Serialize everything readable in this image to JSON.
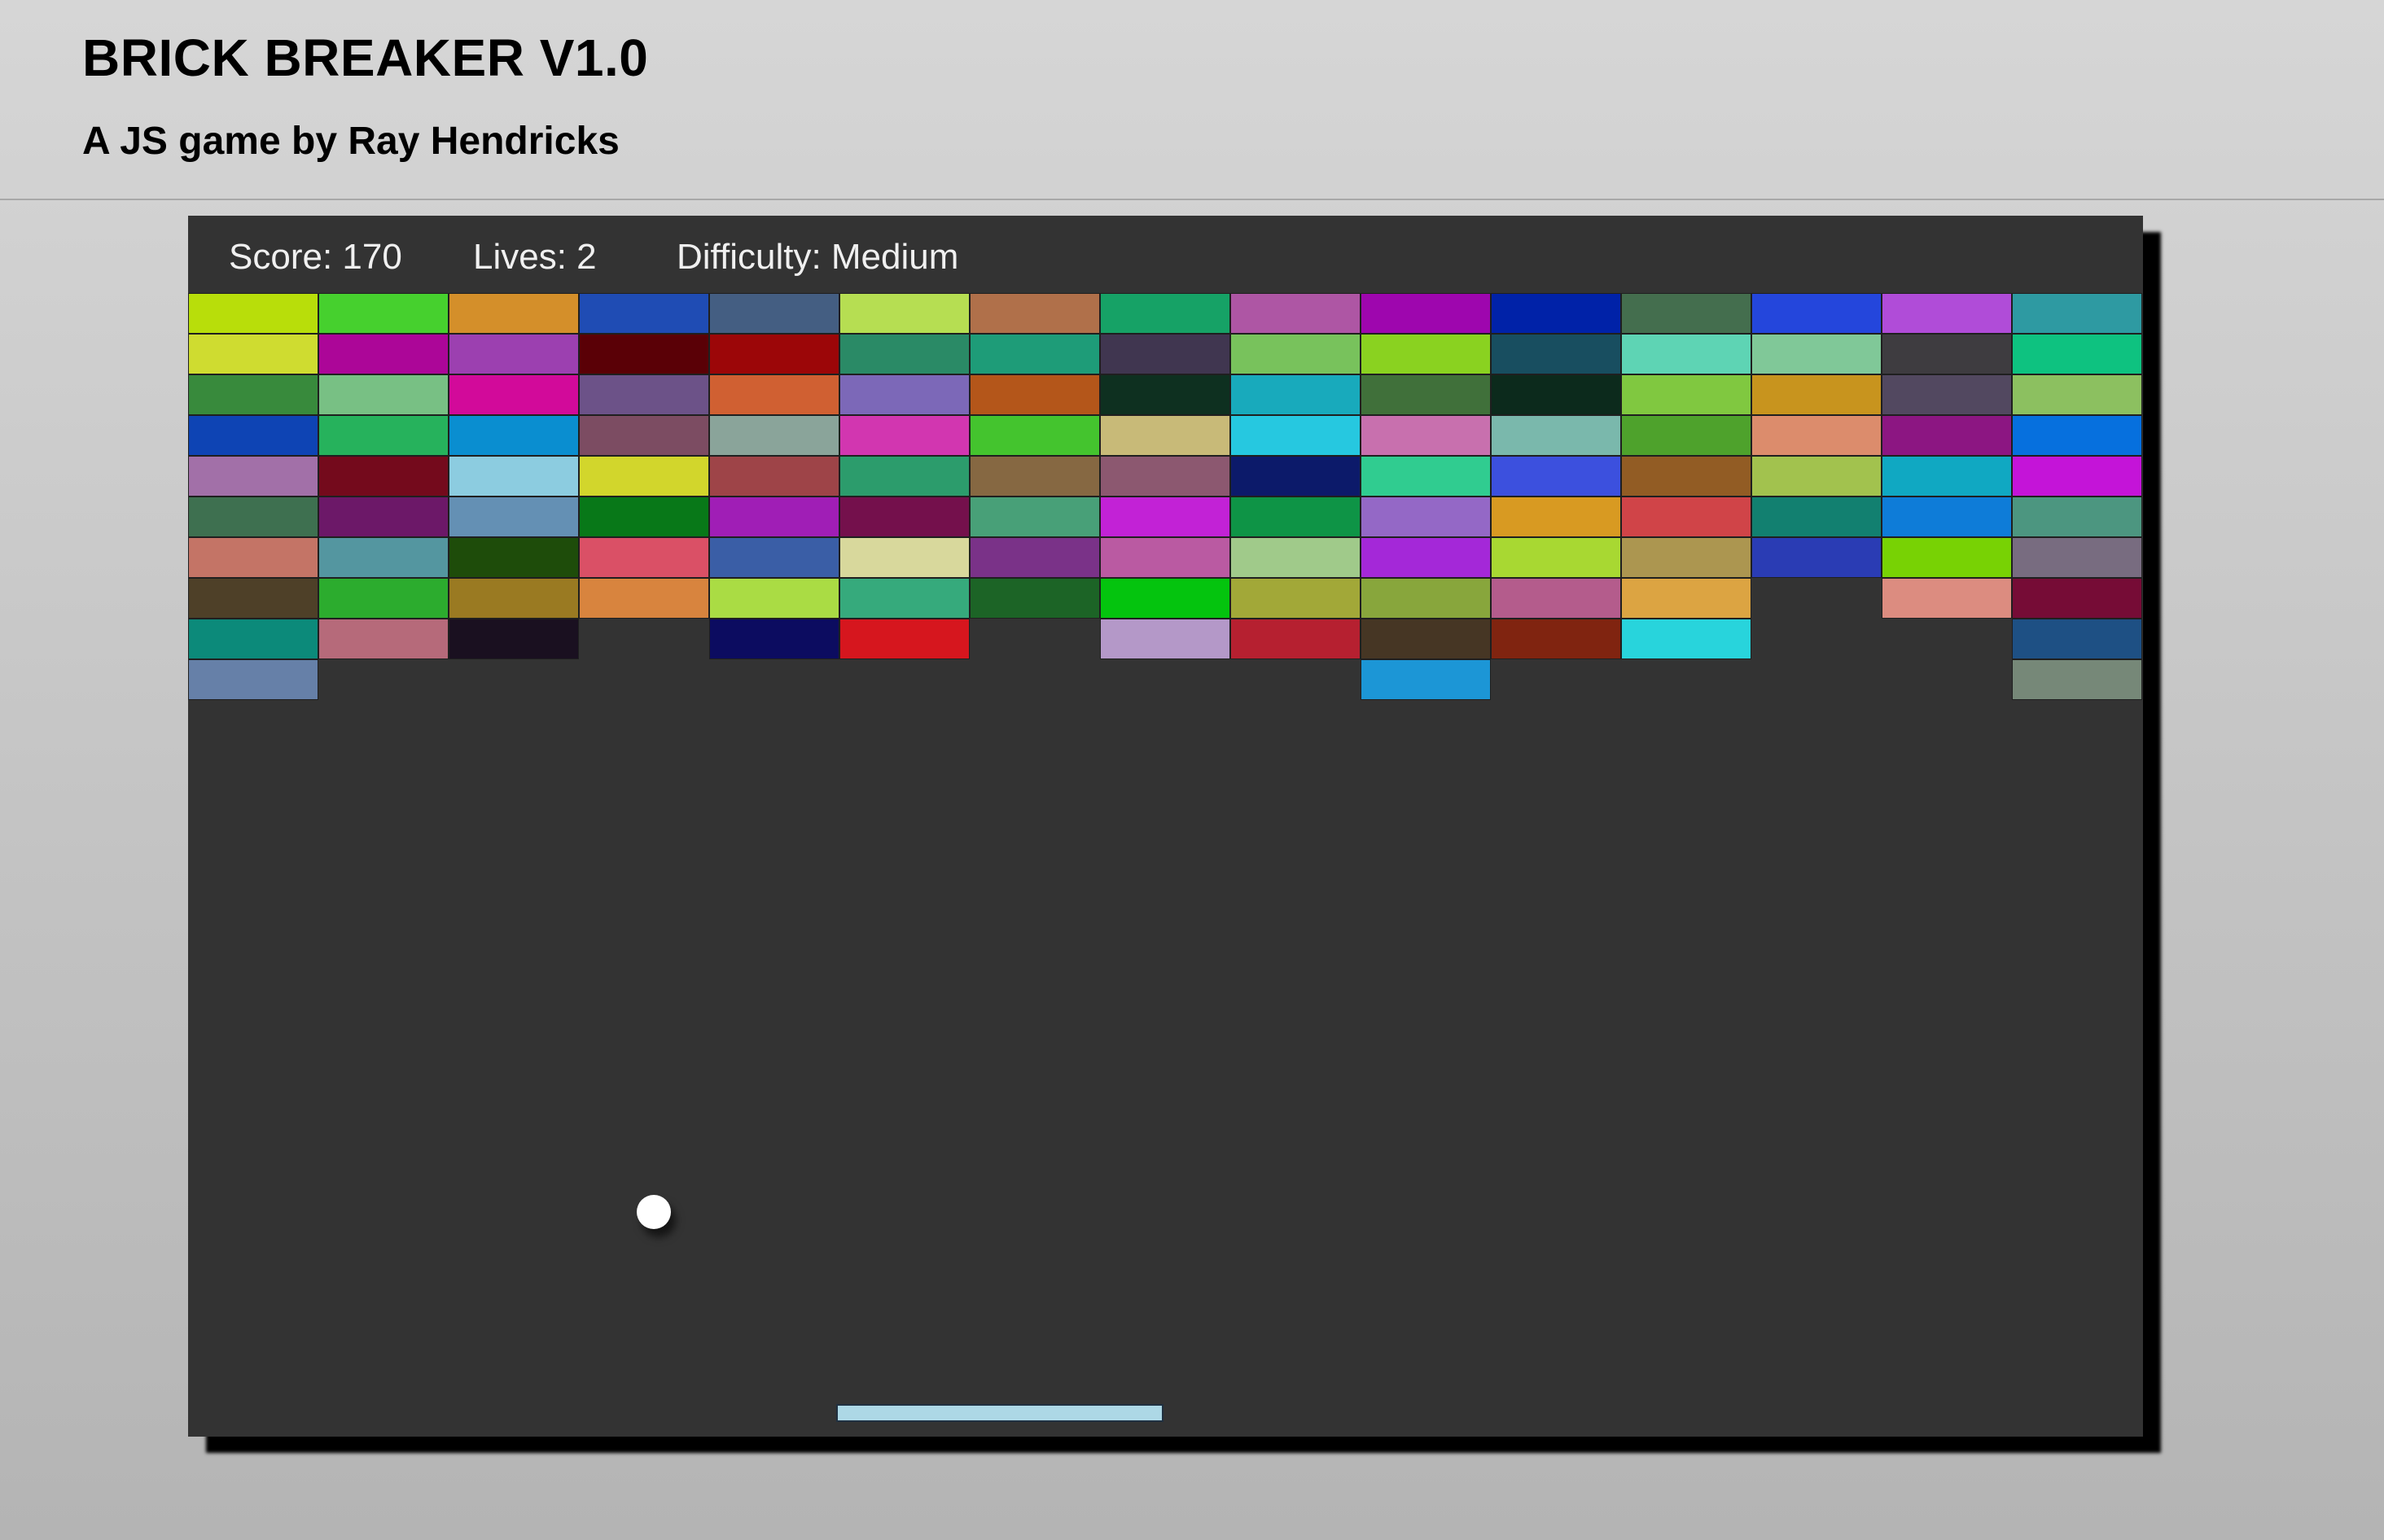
{
  "header": {
    "title": "BRICK BREAKER V1.0",
    "subtitle": "A JS game by Ray Hendricks"
  },
  "hud": {
    "score": "Score: 170",
    "lives": "Lives: 2",
    "difficulty": "Difficulty: Medium"
  },
  "colors": {
    "page_background": "#c8c8c8",
    "game_background": "#333333",
    "hud_text": "#f0f0f0",
    "ball": "#ffffff",
    "paddle": "#add8e6"
  },
  "bricks": [
    [
      "#b8de0a",
      "#46d02e",
      "#d48f2a",
      "#1f4cb4",
      "#445e82",
      "#b6de52",
      "#b0704a",
      "#16a266",
      "#ae56a4",
      "#9e06ae",
      "#0022a8",
      "#446e4e",
      "#2446dc",
      "#b04cd8",
      "#2e9aa2"
    ],
    [
      "#cfdc30",
      "#ac0698",
      "#9c40b0",
      "#5a0006",
      "#9c0608",
      "#2a8a66",
      "#1e9c78",
      "#403650",
      "#78c25c",
      "#8ad220",
      "#184e60",
      "#5ed4b4",
      "#80c898",
      "#3e3c40",
      "#0ec280"
    ],
    [
      "#388a3c",
      "#78c084",
      "#d20a9a",
      "#6c5288",
      "#d06032",
      "#7c68b8",
      "#b4561a",
      "#0e3020",
      "#18aabc",
      "#40703a",
      "#0c2a1c",
      "#80c840",
      "#c8941e",
      "#524860",
      "#8cc060"
    ],
    [
      "#0e44b4",
      "#26b25c",
      "#0a8ed0",
      "#7c4c62",
      "#8aa49a",
      "#d236b0",
      "#44c42e",
      "#c8ba78",
      "#26c8e0",
      "#c870ae",
      "#7ab8ac",
      "#4ea22c",
      "#dc8c6c",
      "#8c1682",
      "#0670de"
    ],
    [
      "#a270a8",
      "#740a1c",
      "#8ccce0",
      "#d2d62c",
      "#9e4448",
      "#2c9c6c",
      "#866842",
      "#8c5870",
      "#0c1a6a",
      "#30cc90",
      "#3c50de",
      "#925c24",
      "#a2c24e",
      "#10a8c2",
      "#c414d8"
    ],
    [
      "#3e7050",
      "#6c1868",
      "#6490b4",
      "#087818",
      "#a01eb6",
      "#74104c",
      "#48a078",
      "#c222d6",
      "#0e9446",
      "#9468c6",
      "#d89a22",
      "#d04448",
      "#128070",
      "#0e7cd8",
      "#4c9680"
    ],
    [
      "#c47466",
      "#5496a0",
      "#1e4c0a",
      "#da5066",
      "#3a5ea6",
      "#d8d89c",
      "#7a3288",
      "#ba5aa2",
      "#a0ca8a",
      "#a428d8",
      "#a8d832",
      "#ac9650",
      "#2a3cb4",
      "#78d204",
      "#786c80"
    ],
    [
      "#4e4028",
      "#2cac2e",
      "#9a7a22",
      "#d8843e",
      "#aadc44",
      "#36aa7c",
      "#1c6426",
      "#04c40e",
      "#a2a838",
      "#88a63c",
      "#b45c8c",
      "#dca442",
      null,
      "#dc8c80",
      "#760c36"
    ],
    [
      "#0c8a7a",
      "#b66a7a",
      "#1a1020",
      null,
      "#0c0c60",
      "#d6161e",
      null,
      "#b498c8",
      "#b62030",
      "#463624",
      "#802410",
      "#28d4dc",
      null,
      null,
      "#1e5084"
    ],
    [
      "#6680a8",
      null,
      null,
      null,
      null,
      null,
      null,
      null,
      null,
      "#1c96d6",
      null,
      null,
      null,
      null,
      "#768878"
    ]
  ]
}
